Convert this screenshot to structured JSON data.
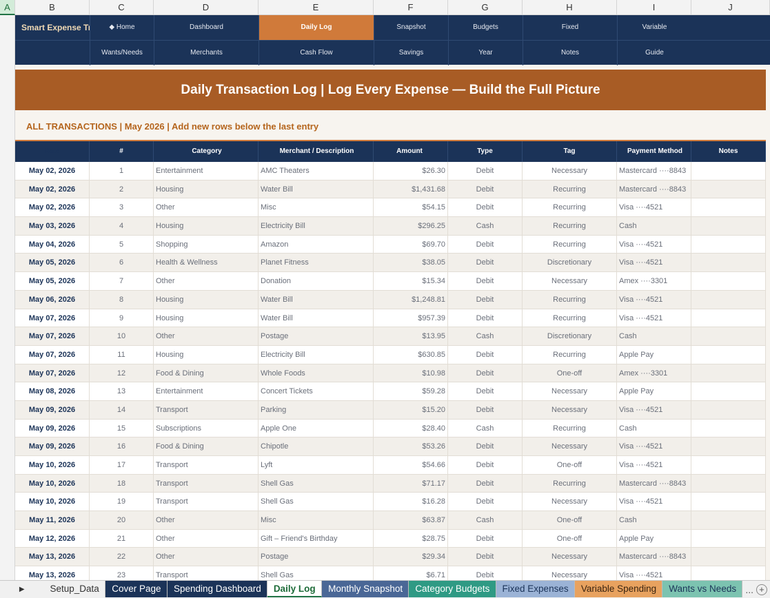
{
  "columns": [
    "A",
    "B",
    "C",
    "D",
    "E",
    "F",
    "G",
    "H",
    "I",
    "J"
  ],
  "nav": {
    "brand": "Smart Expense Tra",
    "row1": [
      "◆ Home",
      "Dashboard",
      "Daily Log",
      "Snapshot",
      "Budgets",
      "Fixed",
      "Variable"
    ],
    "row2": [
      "Wants/Needs",
      "Merchants",
      "Cash Flow",
      "Savings",
      "Year",
      "Notes",
      "Guide"
    ],
    "active": "Daily Log"
  },
  "banner": "Daily Transaction Log  |  Log Every Expense — Build the Full Picture",
  "section_title": "ALL TRANSACTIONS  |  May 2026  |  Add new rows below the last entry",
  "table": {
    "headers": [
      "Date",
      "#",
      "Category",
      "Merchant / Description",
      "Amount",
      "Type",
      "Tag",
      "Payment Method",
      "Notes"
    ],
    "rows": [
      [
        "May 02, 2026",
        "1",
        "Entertainment",
        "AMC Theaters",
        "$26.30",
        "Debit",
        "Necessary",
        "Mastercard ····8843",
        ""
      ],
      [
        "May 02, 2026",
        "2",
        "Housing",
        "Water Bill",
        "$1,431.68",
        "Debit",
        "Recurring",
        "Mastercard ····8843",
        ""
      ],
      [
        "May 02, 2026",
        "3",
        "Other",
        "Misc",
        "$54.15",
        "Debit",
        "Recurring",
        "Visa ····4521",
        ""
      ],
      [
        "May 03, 2026",
        "4",
        "Housing",
        "Electricity Bill",
        "$296.25",
        "Cash",
        "Recurring",
        "Cash",
        ""
      ],
      [
        "May 04, 2026",
        "5",
        "Shopping",
        "Amazon",
        "$69.70",
        "Debit",
        "Recurring",
        "Visa ····4521",
        ""
      ],
      [
        "May 05, 2026",
        "6",
        "Health & Wellness",
        "Planet Fitness",
        "$38.05",
        "Debit",
        "Discretionary",
        "Visa ····4521",
        ""
      ],
      [
        "May 05, 2026",
        "7",
        "Other",
        "Donation",
        "$15.34",
        "Debit",
        "Necessary",
        "Amex ····3301",
        ""
      ],
      [
        "May 06, 2026",
        "8",
        "Housing",
        "Water Bill",
        "$1,248.81",
        "Debit",
        "Recurring",
        "Visa ····4521",
        ""
      ],
      [
        "May 07, 2026",
        "9",
        "Housing",
        "Water Bill",
        "$957.39",
        "Debit",
        "Recurring",
        "Visa ····4521",
        ""
      ],
      [
        "May 07, 2026",
        "10",
        "Other",
        "Postage",
        "$13.95",
        "Cash",
        "Discretionary",
        "Cash",
        ""
      ],
      [
        "May 07, 2026",
        "11",
        "Housing",
        "Electricity Bill",
        "$630.85",
        "Debit",
        "Recurring",
        "Apple Pay",
        ""
      ],
      [
        "May 07, 2026",
        "12",
        "Food & Dining",
        "Whole Foods",
        "$10.98",
        "Debit",
        "One-off",
        "Amex ····3301",
        ""
      ],
      [
        "May 08, 2026",
        "13",
        "Entertainment",
        "Concert Tickets",
        "$59.28",
        "Debit",
        "Necessary",
        "Apple Pay",
        ""
      ],
      [
        "May 09, 2026",
        "14",
        "Transport",
        "Parking",
        "$15.20",
        "Debit",
        "Necessary",
        "Visa ····4521",
        ""
      ],
      [
        "May 09, 2026",
        "15",
        "Subscriptions",
        "Apple One",
        "$28.40",
        "Cash",
        "Recurring",
        "Cash",
        ""
      ],
      [
        "May 09, 2026",
        "16",
        "Food & Dining",
        "Chipotle",
        "$53.26",
        "Debit",
        "Necessary",
        "Visa ····4521",
        ""
      ],
      [
        "May 10, 2026",
        "17",
        "Transport",
        "Lyft",
        "$54.66",
        "Debit",
        "One-off",
        "Visa ····4521",
        ""
      ],
      [
        "May 10, 2026",
        "18",
        "Transport",
        "Shell Gas",
        "$71.17",
        "Debit",
        "Recurring",
        "Mastercard ····8843",
        ""
      ],
      [
        "May 10, 2026",
        "19",
        "Transport",
        "Shell Gas",
        "$16.28",
        "Debit",
        "Necessary",
        "Visa ····4521",
        ""
      ],
      [
        "May 11, 2026",
        "20",
        "Other",
        "Misc",
        "$63.87",
        "Cash",
        "One-off",
        "Cash",
        ""
      ],
      [
        "May 12, 2026",
        "21",
        "Other",
        "Gift – Friend's Birthday",
        "$28.75",
        "Debit",
        "One-off",
        "Apple Pay",
        ""
      ],
      [
        "May 13, 2026",
        "22",
        "Other",
        "Postage",
        "$29.34",
        "Debit",
        "Necessary",
        "Mastercard ····8843",
        ""
      ],
      [
        "May 13, 2026",
        "23",
        "Transport",
        "Shell Gas",
        "$6.71",
        "Debit",
        "Necessary",
        "Visa ····4521",
        ""
      ]
    ]
  },
  "tabs": [
    {
      "label": "Setup_Data",
      "bg": "#f0f0f0",
      "fg": "#333333"
    },
    {
      "label": "Cover Page",
      "bg": "#1b3358",
      "fg": "#ffffff"
    },
    {
      "label": "Spending Dashboard",
      "bg": "#1b3358",
      "fg": "#ffffff"
    },
    {
      "label": "Daily Log",
      "bg": "#ffffff",
      "fg": "#1d6b38",
      "active": true
    },
    {
      "label": "Monthly Snapshot",
      "bg": "#4a6796",
      "fg": "#ffffff"
    },
    {
      "label": "Category Budgets",
      "bg": "#2f9a84",
      "fg": "#ffffff"
    },
    {
      "label": "Fixed Expenses",
      "bg": "#9bb3d6",
      "fg": "#1b3358"
    },
    {
      "label": "Variable Spending",
      "bg": "#e8a25f",
      "fg": "#3a2410"
    },
    {
      "label": "Wants vs Needs",
      "bg": "#7cc3b0",
      "fg": "#1b3358"
    }
  ],
  "tab_more": "...",
  "colors": {
    "navy": "#1b3358",
    "orange": "#d07a3a",
    "banner": "#a85c25",
    "accent_text": "#b5651d"
  }
}
